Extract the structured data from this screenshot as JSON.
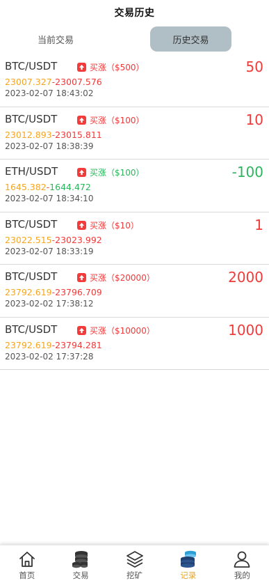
{
  "header": {
    "title": "交易历史"
  },
  "tabs": [
    {
      "label": "当前交易",
      "active": false
    },
    {
      "label": "历史交易",
      "active": true
    }
  ],
  "trades": [
    {
      "pair": "BTC/USDT",
      "direction": "买涨",
      "stake": "（$500）",
      "badge_color": "red",
      "amount": "50",
      "amount_color": "red",
      "open_price": "23007.327",
      "close_price": "23007.576",
      "close_color": "red",
      "time": "2023-02-07 18:43:02"
    },
    {
      "pair": "BTC/USDT",
      "direction": "买涨",
      "stake": "（$100）",
      "badge_color": "red",
      "amount": "10",
      "amount_color": "red",
      "open_price": "23012.893",
      "close_price": "23015.811",
      "close_color": "red",
      "time": "2023-02-07 18:38:39"
    },
    {
      "pair": "ETH/USDT",
      "direction": "买涨",
      "stake": "（$100）",
      "badge_color": "green",
      "amount": "-100",
      "amount_color": "green",
      "open_price": "1645.382",
      "close_price": "1644.472",
      "close_color": "green",
      "time": "2023-02-07 18:34:10"
    },
    {
      "pair": "BTC/USDT",
      "direction": "买涨",
      "stake": "（$10）",
      "badge_color": "red",
      "amount": "1",
      "amount_color": "red",
      "open_price": "23022.515",
      "close_price": "23023.992",
      "close_color": "red",
      "time": "2023-02-07 18:33:19"
    },
    {
      "pair": "BTC/USDT",
      "direction": "买涨",
      "stake": "（$20000）",
      "badge_color": "red",
      "amount": "2000",
      "amount_color": "red",
      "open_price": "23792.619",
      "close_price": "23796.709",
      "close_color": "red",
      "time": "2023-02-02 17:38:12"
    },
    {
      "pair": "BTC/USDT",
      "direction": "买涨",
      "stake": "（$10000）",
      "badge_color": "red",
      "amount": "1000",
      "amount_color": "red",
      "open_price": "23792.619",
      "close_price": "23794.281",
      "close_color": "red",
      "time": "2023-02-02 17:37:28"
    }
  ],
  "colors": {
    "red": "#ef3a3a",
    "green": "#2bb55c",
    "open_price": "#f5a623",
    "active_tab_bg": "#b0bec5",
    "nav_active": "#e5a632"
  },
  "nav": [
    {
      "label": "首页",
      "icon": "home-icon",
      "active": false
    },
    {
      "label": "交易",
      "icon": "coins-icon",
      "active": false
    },
    {
      "label": "挖矿",
      "icon": "layers-icon",
      "active": false
    },
    {
      "label": "记录",
      "icon": "records-icon",
      "active": true
    },
    {
      "label": "我的",
      "icon": "user-icon",
      "active": false
    }
  ]
}
